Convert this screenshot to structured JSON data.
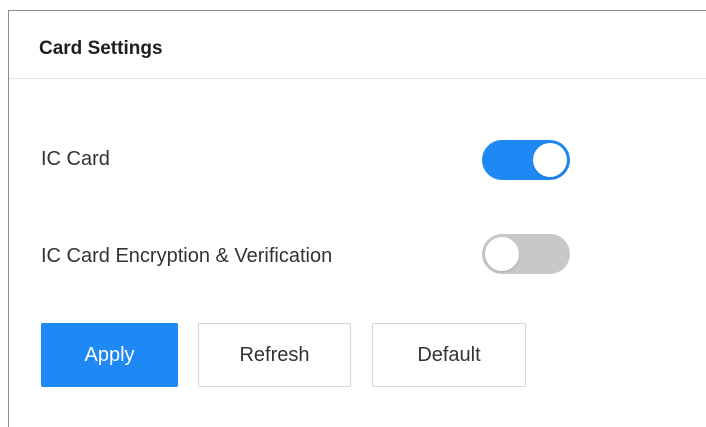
{
  "header": {
    "title": "Card Settings"
  },
  "settings": [
    {
      "label": "IC Card",
      "enabled": true
    },
    {
      "label": "IC Card Encryption & Verification",
      "enabled": false
    }
  ],
  "buttons": {
    "apply": "Apply",
    "refresh": "Refresh",
    "default": "Default"
  },
  "colors": {
    "accent": "#1e88f5",
    "toggle_off": "#c8c8c8"
  }
}
